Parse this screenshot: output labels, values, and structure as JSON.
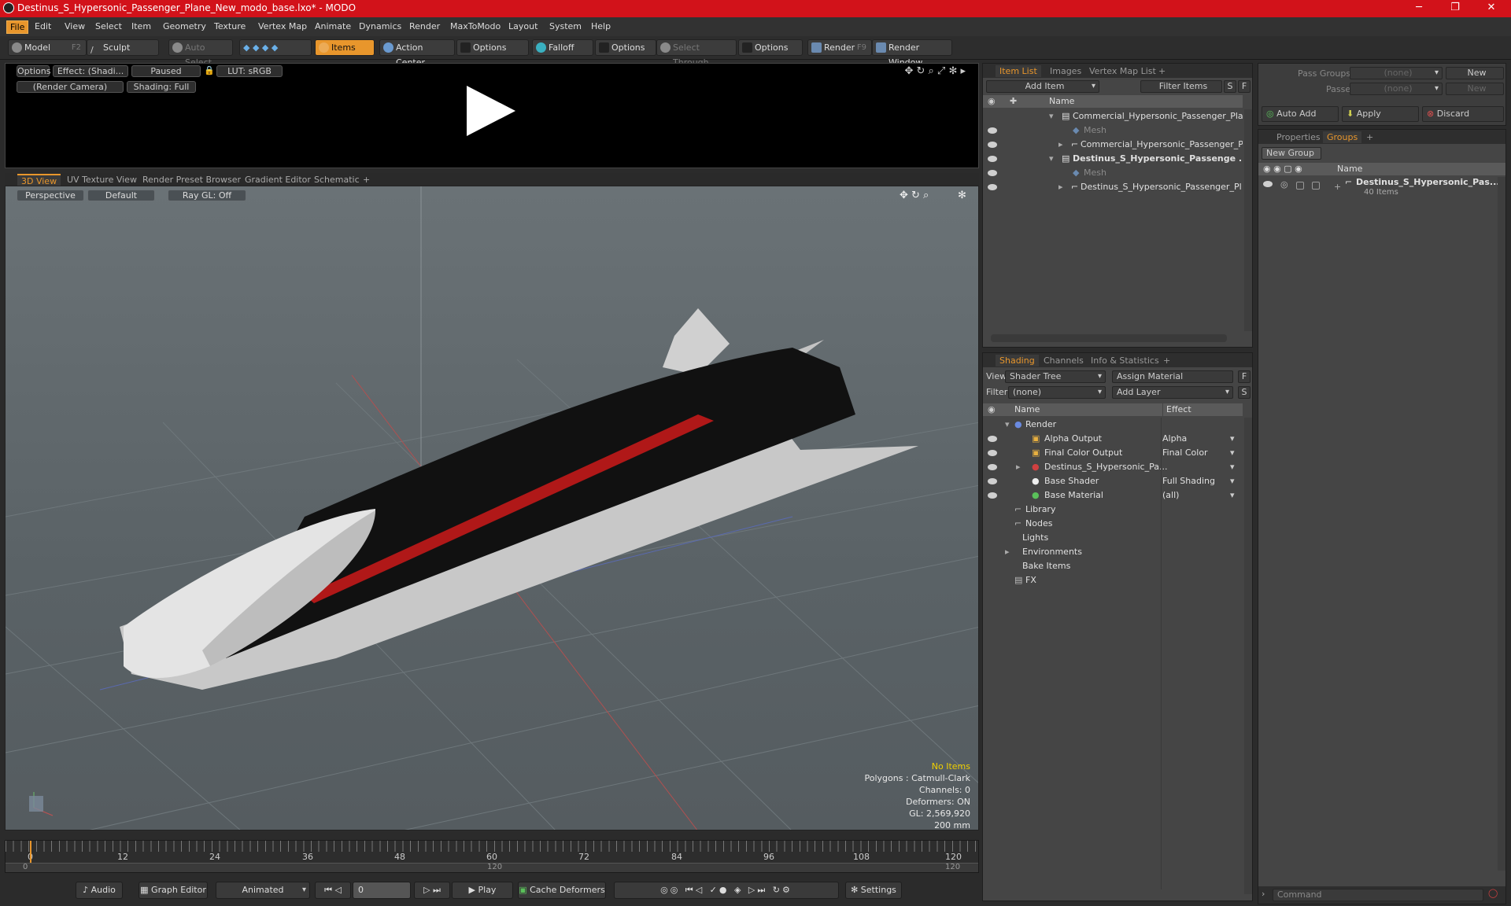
{
  "window": {
    "title": "Destinus_S_Hypersonic_Passenger_Plane_New_modo_base.lxo* - MODO",
    "minimize": "─",
    "maximize": "❐",
    "close": "✕"
  },
  "menu": [
    "File",
    "Edit",
    "View",
    "Select",
    "Item",
    "Geometry",
    "Texture",
    "Vertex Map",
    "Animate",
    "Dynamics",
    "Render",
    "MaxToModo",
    "Layout",
    "System",
    "Help"
  ],
  "toolbar": {
    "model": "Model",
    "model_key": "F2",
    "sculpt": "Sculpt",
    "auto_select": "Auto Select",
    "items": "Items",
    "action_center": "Action Center",
    "options1": "Options",
    "falloff": "Falloff",
    "options2": "Options",
    "select_through": "Select Through",
    "options3": "Options",
    "render": "Render",
    "render_key": "F9",
    "render_window": "Render Window"
  },
  "preview": {
    "options": "Options",
    "effect": "Effect: (Shadi...",
    "paused": "Paused",
    "lut": "LUT: sRGB",
    "camera": "(Render Camera)",
    "shading": "Shading: Full"
  },
  "view_tabs": [
    "3D View",
    "UV Texture View",
    "Render Preset Browser",
    "Gradient Editor",
    "Schematic",
    "+"
  ],
  "viewport": {
    "perspective": "Perspective",
    "default": "Default",
    "raygl": "Ray GL: Off"
  },
  "stats": {
    "items": "No Items",
    "polygons": "Polygons : Catmull-Clark",
    "channels": "Channels: 0",
    "deformers": "Deformers: ON",
    "gl": "GL: 2,569,920",
    "scale": "200 mm"
  },
  "timeline": {
    "ticks": [
      "0",
      "12",
      "24",
      "36",
      "48",
      "60",
      "72",
      "84",
      "96",
      "108",
      "120"
    ],
    "start": "0",
    "mid": "120",
    "end": "120"
  },
  "bottom": {
    "audio": "Audio",
    "graph_editor": "Graph Editor",
    "animated": "Animated",
    "frame": "0",
    "play": "Play",
    "cache": "Cache Deformers",
    "settings": "Settings"
  },
  "item_list": {
    "tabs": [
      "Item List",
      "Images",
      "Vertex Map List",
      "+"
    ],
    "add_item": "Add Item",
    "filter_items": "Filter Items",
    "s": "S",
    "f": "F",
    "col_name": "Name",
    "rows": [
      {
        "label": "Commercial_Hypersonic_Passenger_Plan ...",
        "bold": false,
        "dim": false
      },
      {
        "label": "Mesh",
        "bold": false,
        "dim": true
      },
      {
        "label": "Commercial_Hypersonic_Passenger_Pl ...",
        "bold": false,
        "dim": false
      },
      {
        "label": "Destinus_S_Hypersonic_Passenge ...",
        "bold": true,
        "dim": false
      },
      {
        "label": "Mesh",
        "bold": false,
        "dim": true
      },
      {
        "label": "Destinus_S_Hypersonic_Passenger_Pl ...",
        "bold": false,
        "dim": false
      }
    ]
  },
  "shading": {
    "tabs": [
      "Shading",
      "Channels",
      "Info & Statistics",
      "+"
    ],
    "view_label": "View",
    "view_value": "Shader Tree",
    "assign_material": "Assign Material",
    "f": "F",
    "filter_label": "Filter",
    "filter_value": "(none)",
    "add_layer": "Add Layer",
    "s": "S",
    "col_name": "Name",
    "col_effect": "Effect",
    "rows": [
      {
        "label": "Render",
        "effect": ""
      },
      {
        "label": "Alpha Output",
        "effect": "Alpha"
      },
      {
        "label": "Final Color Output",
        "effect": "Final Color"
      },
      {
        "label": "Destinus_S_Hypersonic_Pa...",
        "effect": ""
      },
      {
        "label": "Base Shader",
        "effect": "Full Shading"
      },
      {
        "label": "Base Material",
        "effect": "(all)"
      },
      {
        "label": "Library",
        "effect": ""
      },
      {
        "label": "Nodes",
        "effect": ""
      },
      {
        "label": "Lights",
        "effect": ""
      },
      {
        "label": "Environments",
        "effect": ""
      },
      {
        "label": "Bake Items",
        "effect": ""
      },
      {
        "label": "FX",
        "effect": ""
      }
    ]
  },
  "passes": {
    "pass_groups": "Pass Groups",
    "passes": "Passes",
    "none": "(none)",
    "new": "New",
    "auto_add": "Auto Add",
    "apply": "Apply",
    "discard": "Discard"
  },
  "groups": {
    "tabs": [
      "Properties",
      "Groups",
      "+"
    ],
    "new_group": "New Group",
    "col_name": "Name",
    "item_name": "Destinus_S_Hypersonic_Pas...",
    "item_count": "40 Items"
  },
  "command": {
    "placeholder": "Command"
  }
}
